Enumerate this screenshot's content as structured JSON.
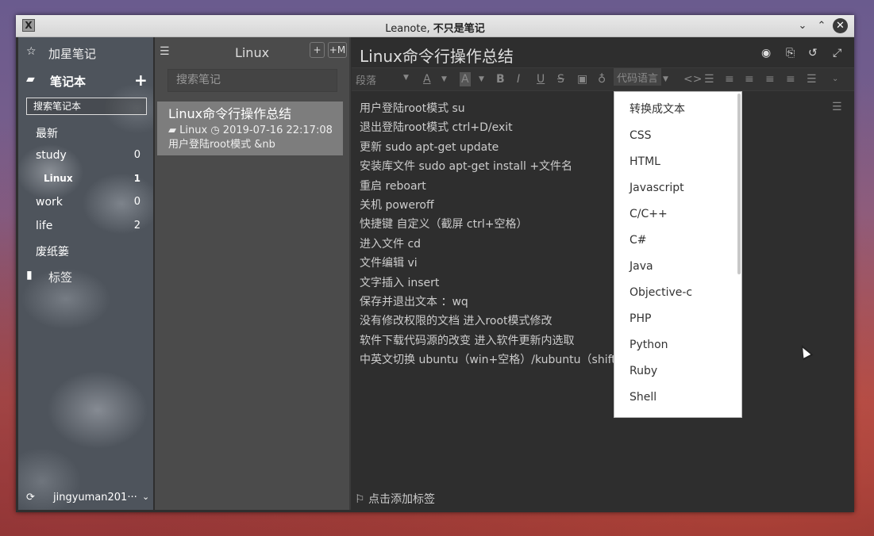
{
  "window": {
    "title_plain": "Leanote, ",
    "title_bold": "不只是笔记",
    "app_icon": "X",
    "controls": [
      "minimize",
      "maximize",
      "close"
    ]
  },
  "sidebar": {
    "starred": "加星笔记",
    "notebooks": "笔记本",
    "search_placeholder": "搜索笔记本",
    "items": [
      {
        "label": "最新",
        "count": ""
      },
      {
        "label": "study",
        "count": "0"
      },
      {
        "label": "Linux",
        "count": "1"
      },
      {
        "label": "work",
        "count": "0"
      },
      {
        "label": "life",
        "count": "2"
      },
      {
        "label": "废纸篓",
        "count": ""
      }
    ],
    "tags": "标签",
    "user": "jingyuman201···"
  },
  "notelist": {
    "title": "Linux",
    "add_label": "+",
    "add_md_label": "+M",
    "search_placeholder": "搜索笔记",
    "notes": [
      {
        "title": "Linux命令行操作总结",
        "notebook": "Linux",
        "date": "2019-07-16 22:17:08",
        "preview": "用户登陆root模式 &nb"
      }
    ]
  },
  "editor": {
    "title": "Linux命令行操作总结",
    "toolbar": {
      "paragraph": "段落",
      "code_lang": "代码语言"
    },
    "lines": [
      "用户登陆root模式    su",
      "退出登陆root模式     ctrl+D/exit",
      "更新    sudo apt-get update",
      "安装库文件    sudo  apt-get install +文件名",
      "重启    reboart",
      "关机    poweroff",
      "快捷键    自定义（截屏    ctrl+空格）",
      "进入文件    cd",
      "文件编辑    vi",
      "文字插入    insert",
      "保存并退出文本    ：wq",
      "没有修改权限的文档    进入root模式修改",
      "软件下载代码源的改变    进入软件更新内选取",
      "中英文切换    ubuntu（win+空格）/kubuntu（shift"
    ],
    "add_tag": "点击添加标签"
  },
  "dropdown": {
    "items": [
      "转换成文本",
      "CSS",
      "HTML",
      "Javascript",
      "C/C++",
      "C#",
      "Java",
      "Objective-c",
      "PHP",
      "Python",
      "Ruby",
      "Shell"
    ]
  }
}
